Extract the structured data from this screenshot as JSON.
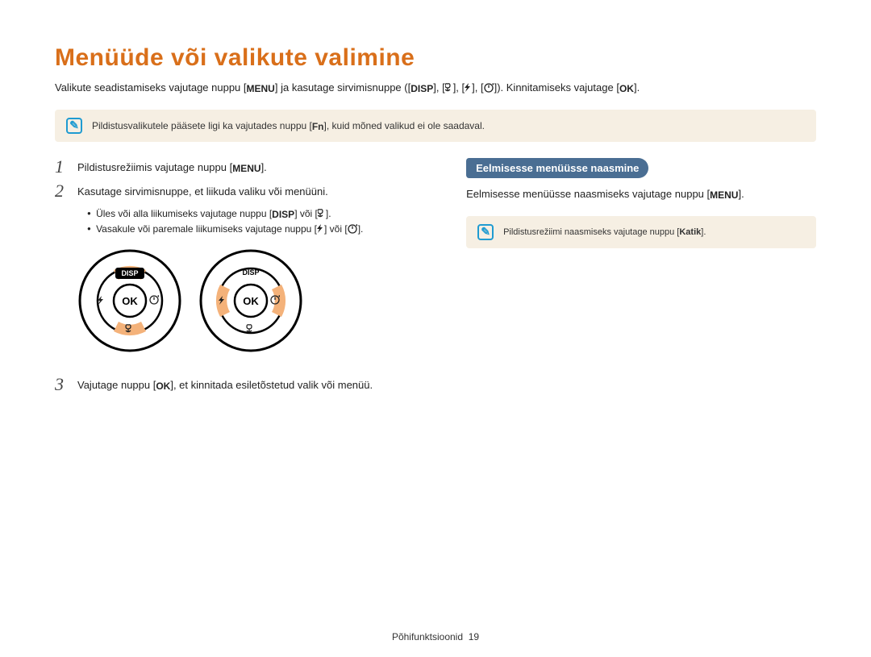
{
  "title": "Menüüde või valikute valimine",
  "intro": {
    "part1": "Valikute seadistamiseks vajutage nuppu [",
    "menu": "MENU",
    "part2": "] ja kasutage sirvimisnuppe ([",
    "disp": "DISP",
    "part3": "], [",
    "part4": "], [",
    "part5": "], [",
    "part6": "]). Kinnitamiseks vajutage [",
    "ok": "OK",
    "part7": "]."
  },
  "note1": {
    "part1": "Pildistusvalikutele pääsete ligi ka vajutades nuppu [",
    "fn": "Fn",
    "part2": "], kuid mõned valikud ei ole saadaval."
  },
  "steps": {
    "s1": {
      "num": "1",
      "a": "Pildistusrežiimis vajutage nuppu [",
      "menu": "MENU",
      "b": "]."
    },
    "s2": {
      "num": "2",
      "text": "Kasutage sirvimisnuppe, et liikuda valiku või menüüni.",
      "b1a": "Üles või alla liikumiseks vajutage nuppu [",
      "b1_disp": "DISP",
      "b1b": "] või [",
      "b1c": "].",
      "b2a": "Vasakule või paremale liikumiseks vajutage nuppu [",
      "b2b": "] või [",
      "b2c": "]."
    },
    "s3": {
      "num": "3",
      "a": "Vajutage nuppu [",
      "ok": "OK",
      "b": "], et kinnitada esiletõstetud valik või menüü."
    }
  },
  "dial": {
    "disp": "DISP",
    "ok": "OK"
  },
  "right": {
    "header": "Eelmisesse menüüsse naasmine",
    "a": "Eelmisesse menüüsse naasmiseks vajutage nuppu [",
    "menu": "MENU",
    "b": "]."
  },
  "note2": {
    "a": "Pildistusrežiimi naasmiseks vajutage nuppu [",
    "katik": "Katik",
    "b": "]."
  },
  "footer": {
    "section": "Põhifunktsioonid",
    "page": "19"
  }
}
